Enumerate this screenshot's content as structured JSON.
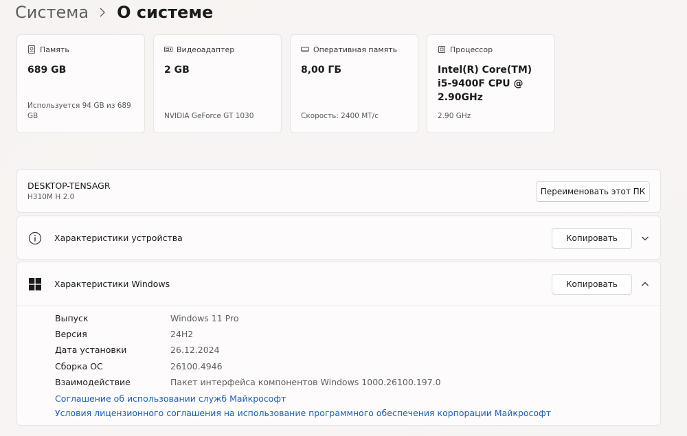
{
  "breadcrumb": {
    "parent": "Система",
    "current": "О системе"
  },
  "cards": [
    {
      "icon": "storage-icon",
      "title": "Память",
      "value": "689 GB",
      "sub": "Используется 94 GB из 689 GB"
    },
    {
      "icon": "display-adapter-icon",
      "title": "Видеоадаптер",
      "value": "2 GB",
      "sub": "NVIDIA GeForce GT 1030"
    },
    {
      "icon": "ram-icon",
      "title": "Оперативная память",
      "value": "8,00 ГБ",
      "sub": "Скорость: 2400 MT/c"
    },
    {
      "icon": "processor-icon",
      "title": "Процессор",
      "value": "Intel(R) Core(TM) i5-9400F CPU @ 2.90GHz",
      "sub": "2.90 GHz"
    }
  ],
  "device": {
    "name": "DESKTOP-TENSAGR",
    "model": "H310M H 2.0",
    "rename_label": "Переименовать этот ПК"
  },
  "device_specs": {
    "title": "Характеристики устройства",
    "copy_label": "Копировать"
  },
  "windows_specs": {
    "title": "Характеристики Windows",
    "copy_label": "Копировать",
    "rows": [
      {
        "label": "Выпуск",
        "value": "Windows 11 Pro"
      },
      {
        "label": "Версия",
        "value": "24H2"
      },
      {
        "label": "Дата установки",
        "value": "26.12.2024"
      },
      {
        "label": "Сборка ОС",
        "value": "26100.4946"
      },
      {
        "label": "Взаимодействие",
        "value": "Пакет интерфейса компонентов Windows 1000.26100.197.0"
      }
    ],
    "links": [
      "Соглашение об использовании служб Майкрософт",
      "Условия лицензионного соглашения на использование программного обеспечения корпорации Майкрософт"
    ]
  }
}
